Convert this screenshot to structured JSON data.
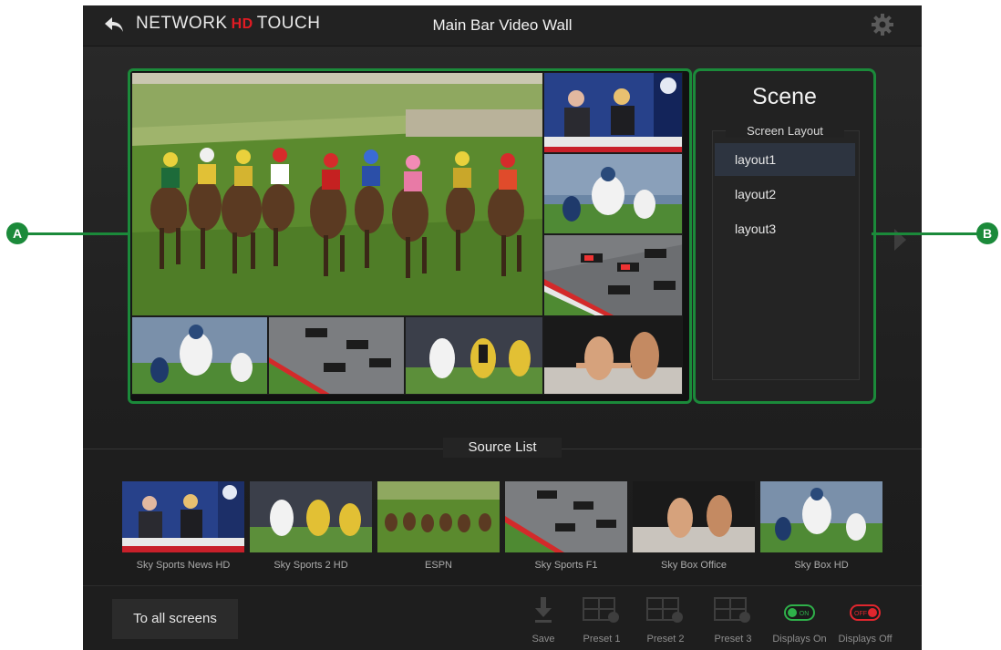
{
  "app": {
    "logo_left": "NETWORK",
    "logo_hd": "HD",
    "logo_right": "TOUCH",
    "title": "Main Bar Video Wall"
  },
  "callouts": {
    "a": "A",
    "b": "B"
  },
  "scene": {
    "title": "Scene",
    "layout_label": "Screen Layout",
    "layouts": [
      "layout1",
      "layout2",
      "layout3"
    ],
    "selected": "layout1"
  },
  "source_list": {
    "title": "Source List",
    "sources": [
      "Sky Sports News HD",
      "Sky Sports 2 HD",
      "ESPN",
      "Sky Sports F1",
      "Sky Box Office",
      "Sky Box HD"
    ]
  },
  "bottom": {
    "to_all": "To all screens",
    "save": "Save",
    "preset1": "Preset 1",
    "preset2": "Preset 2",
    "preset3": "Preset 3",
    "displays_on": "Displays On",
    "displays_off": "Displays Off",
    "toggle_on": "ON",
    "toggle_off": "OFF"
  },
  "colors": {
    "accent_green": "#1b8a3a",
    "brand_red": "#e21b23",
    "toggle_on": "#2fb04a",
    "toggle_off": "#e0262e"
  }
}
